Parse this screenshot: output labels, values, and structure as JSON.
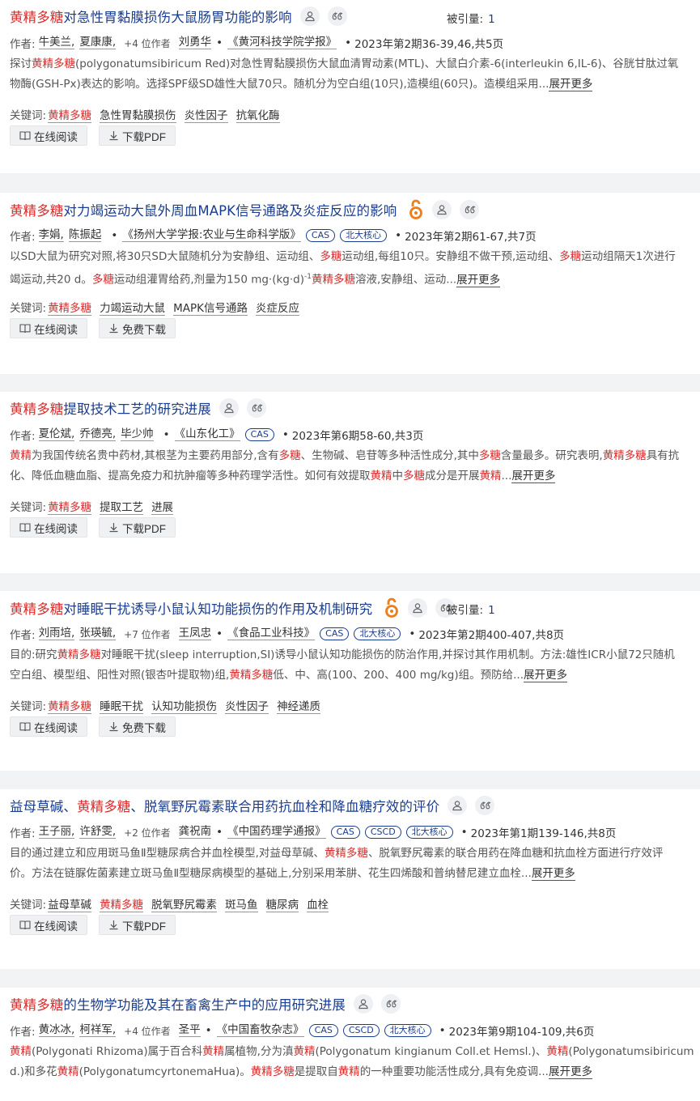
{
  "labels": {
    "author": "作者:",
    "keywords": "关键词:",
    "cite": "被引量:",
    "expand": "展开更多",
    "read_online": "在线阅读",
    "download_pdf": "下载PDF",
    "free_download": "免费下载"
  },
  "colors": {
    "highlight": "#d92b2b",
    "title": "#1a3d8f",
    "oa_icon": "#f07c1a"
  },
  "results": [
    {
      "title": [
        {
          "t": "黄精多糖",
          "hl": true
        },
        {
          "t": "对急性胃黏膜损伤大鼠肠胃功能的影响",
          "hl": false
        }
      ],
      "cite_count": "1",
      "authors": [
        "牛美兰,",
        "夏康康,"
      ],
      "more_authors": "+4 位作者",
      "last_author": "刘勇华",
      "journal": "《黄河科技学院学报》",
      "tags": [],
      "issue": "2023年第2期36-39,46,共5页",
      "abstract": [
        [
          {
            "t": "探讨",
            "hl": false
          },
          {
            "t": "黄精多糖",
            "hl": true
          },
          {
            "t": "(polygonatumsibiricum Red)对急性胃黏膜损伤大鼠血清胃动素(MTL)、大鼠白介素-6(interleukin 6,IL-6)、谷胱甘肽过氧",
            "hl": false
          }
        ],
        [
          {
            "t": "物酶(GSH-Px)表达的影响。选择SPF级SD雄性大鼠70只。随机分为空白组(10只),造模组(60只)。造模组采用...",
            "hl": false
          }
        ]
      ],
      "keywords": [
        {
          "t": "黄精多糖",
          "hl": true
        },
        {
          "t": "急性胃黏膜损伤",
          "hl": false
        },
        {
          "t": "炎性因子",
          "hl": false
        },
        {
          "t": "抗氧化酶",
          "hl": false
        }
      ],
      "download": "下载PDF",
      "oa": false
    },
    {
      "title": [
        {
          "t": "黄精多糖",
          "hl": true
        },
        {
          "t": "对力竭运动大鼠外周血MAPK信号通路及炎症反应的影响",
          "hl": false
        }
      ],
      "cite_count": "",
      "authors": [
        "李娟,",
        "陈振起"
      ],
      "more_authors": "",
      "last_author": "",
      "journal": "《扬州大学学报:农业与生命科学版》",
      "tags": [
        "CAS",
        "北大核心"
      ],
      "issue": "2023年第2期61-67,共7页",
      "abstract": [
        [
          {
            "t": "以SD大鼠为研究对照,将30只SD大鼠随机分为安静组、运动组、",
            "hl": false
          },
          {
            "t": "多糖",
            "hl": true
          },
          {
            "t": "运动组,每组10只。安静组不做干预,运动组、",
            "hl": false
          },
          {
            "t": "多糖",
            "hl": true
          },
          {
            "t": "运动组隔天1次进行",
            "hl": false
          }
        ],
        [
          {
            "t": "竭运动,共20 d。",
            "hl": false
          },
          {
            "t": "多糖",
            "hl": true
          },
          {
            "t": "运动组灌胃给药,剂量为150 mg·(kg·d)",
            "hl": false
          },
          {
            "t": "-1",
            "hl": false,
            "sup": true
          },
          {
            "t": "黄精多糖",
            "hl": true
          },
          {
            "t": "溶液,安静组、运动...",
            "hl": false
          }
        ]
      ],
      "keywords": [
        {
          "t": "黄精多糖",
          "hl": true
        },
        {
          "t": "力竭运动大鼠",
          "hl": false
        },
        {
          "t": "MAPK信号通路",
          "hl": false
        },
        {
          "t": "炎症反应",
          "hl": false
        }
      ],
      "download": "免费下载",
      "oa": true
    },
    {
      "title": [
        {
          "t": "黄精多糖",
          "hl": true
        },
        {
          "t": "提取技术工艺的研究进展",
          "hl": false
        }
      ],
      "cite_count": "",
      "authors": [
        "夏伦斌,",
        "乔德亮,",
        "毕少帅"
      ],
      "more_authors": "",
      "last_author": "",
      "journal": "《山东化工》",
      "tags": [
        "CAS"
      ],
      "issue": "2023年第6期58-60,共3页",
      "abstract": [
        [
          {
            "t": "黄精",
            "hl": true
          },
          {
            "t": "为我国传统名贵中药材,其根茎为主要药用部分,含有",
            "hl": false
          },
          {
            "t": "多糖",
            "hl": true
          },
          {
            "t": "、生物碱、皂苷等多种活性成分,其中",
            "hl": false
          },
          {
            "t": "多糖",
            "hl": true
          },
          {
            "t": "含量最多。研究表明,",
            "hl": false
          },
          {
            "t": "黄精多糖",
            "hl": true
          },
          {
            "t": "具有抗",
            "hl": false
          }
        ],
        [
          {
            "t": "化、降低血糖血脂、提高免疫力和抗肿瘤等多种药理学活性。如何有效提取",
            "hl": false
          },
          {
            "t": "黄精",
            "hl": true
          },
          {
            "t": "中",
            "hl": false
          },
          {
            "t": "多糖",
            "hl": true
          },
          {
            "t": "成分是开展",
            "hl": false
          },
          {
            "t": "黄精",
            "hl": true
          },
          {
            "t": "...",
            "hl": false
          }
        ]
      ],
      "keywords": [
        {
          "t": "黄精多糖",
          "hl": true
        },
        {
          "t": "提取工艺",
          "hl": false
        },
        {
          "t": "进展",
          "hl": false
        }
      ],
      "download": "下载PDF",
      "oa": false
    },
    {
      "title": [
        {
          "t": "黄精多糖",
          "hl": true
        },
        {
          "t": "对睡眠干扰诱导小鼠认知功能损伤的作用及机制研究",
          "hl": false
        }
      ],
      "cite_count": "1",
      "authors": [
        "刘雨培,",
        "张瑛毓,"
      ],
      "more_authors": "+7 位作者",
      "last_author": "王凤忠",
      "journal": "《食品工业科技》",
      "tags": [
        "CAS",
        "北大核心"
      ],
      "issue": "2023年第2期400-407,共8页",
      "abstract": [
        [
          {
            "t": "目的:研究",
            "hl": false
          },
          {
            "t": "黄精多糖",
            "hl": true
          },
          {
            "t": "对睡眠干扰(sleep interruption,SI)诱导小鼠认知功能损伤的防治作用,并探讨其作用机制。方法:雄性ICR小鼠72只随机",
            "hl": false
          }
        ],
        [
          {
            "t": "空白组、模型组、阳性对照(银杏叶提取物)组,",
            "hl": false
          },
          {
            "t": "黄精多糖",
            "hl": true
          },
          {
            "t": "低、中、高(100、200、400 mg/kg)组。预防给...",
            "hl": false
          }
        ]
      ],
      "keywords": [
        {
          "t": "黄精多糖",
          "hl": true
        },
        {
          "t": "睡眠干扰",
          "hl": false
        },
        {
          "t": "认知功能损伤",
          "hl": false
        },
        {
          "t": "炎性因子",
          "hl": false
        },
        {
          "t": "神经递质",
          "hl": false
        }
      ],
      "download": "免费下载",
      "oa": true
    },
    {
      "title": [
        {
          "t": "益母草碱、",
          "hl": false
        },
        {
          "t": "黄精多糖",
          "hl": true
        },
        {
          "t": "、脱氧野尻霉素联合用药抗血栓和降血糖疗效的评价",
          "hl": false
        }
      ],
      "cite_count": "",
      "authors": [
        "王子丽,",
        "许舒雯,"
      ],
      "more_authors": "+2 位作者",
      "last_author": "龚祝南",
      "journal": "《中国药理学通报》",
      "tags": [
        "CAS",
        "CSCD",
        "北大核心"
      ],
      "issue": "2023年第1期139-146,共8页",
      "abstract": [
        [
          {
            "t": "目的通过建立和应用斑马鱼Ⅱ型糖尿病合并血栓模型,对益母草碱、",
            "hl": false
          },
          {
            "t": "黄精多糖",
            "hl": true
          },
          {
            "t": "、脱氧野尻霉素的联合用药在降血糖和抗血栓方面进行疗效评",
            "hl": false
          }
        ],
        [
          {
            "t": "价。方法在链脲佐菌素建立斑马鱼Ⅱ型糖尿病模型的基础上,分别采用苯肼、花生四烯酸和普纳替尼建立血栓...",
            "hl": false
          }
        ]
      ],
      "keywords": [
        {
          "t": "益母草碱",
          "hl": false
        },
        {
          "t": "黄精多糖",
          "hl": true
        },
        {
          "t": "脱氧野尻霉素",
          "hl": false
        },
        {
          "t": "斑马鱼",
          "hl": false
        },
        {
          "t": "糖尿病",
          "hl": false
        },
        {
          "t": "血栓",
          "hl": false
        }
      ],
      "download": "下载PDF",
      "oa": false
    },
    {
      "title": [
        {
          "t": "黄精多糖",
          "hl": true
        },
        {
          "t": "的生物学功能及其在畜禽生产中的应用研究进展",
          "hl": false
        }
      ],
      "cite_count": "",
      "authors": [
        "黄冰冰,",
        "柯祥军,"
      ],
      "more_authors": "+4 位作者",
      "last_author": "圣平",
      "journal": "《中国畜牧杂志》",
      "tags": [
        "CAS",
        "CSCD",
        "北大核心"
      ],
      "issue": "2023年第9期104-109,共6页",
      "abstract": [
        [
          {
            "t": "黄精",
            "hl": true
          },
          {
            "t": "(Polygonati Rhizoma)属于百合科",
            "hl": false
          },
          {
            "t": "黄精",
            "hl": true
          },
          {
            "t": "属植物,分为滇",
            "hl": false
          },
          {
            "t": "黄精",
            "hl": true
          },
          {
            "t": "(Polygonatum kingianum Coll.et Hemsl.)、",
            "hl": false
          },
          {
            "t": "黄精",
            "hl": true
          },
          {
            "t": "(Polygonatumsibiricum",
            "hl": false
          }
        ],
        [
          {
            "t": "d.)和多花",
            "hl": false
          },
          {
            "t": "黄精",
            "hl": true
          },
          {
            "t": "(PolygonatumcyrtonemaHua)。",
            "hl": false
          },
          {
            "t": "黄精多糖",
            "hl": true
          },
          {
            "t": "是提取自",
            "hl": false
          },
          {
            "t": "黄精",
            "hl": true
          },
          {
            "t": "的一种重要功能活性成分,具有免疫调...",
            "hl": false
          }
        ]
      ],
      "keywords": [],
      "download": "",
      "oa": false
    }
  ]
}
